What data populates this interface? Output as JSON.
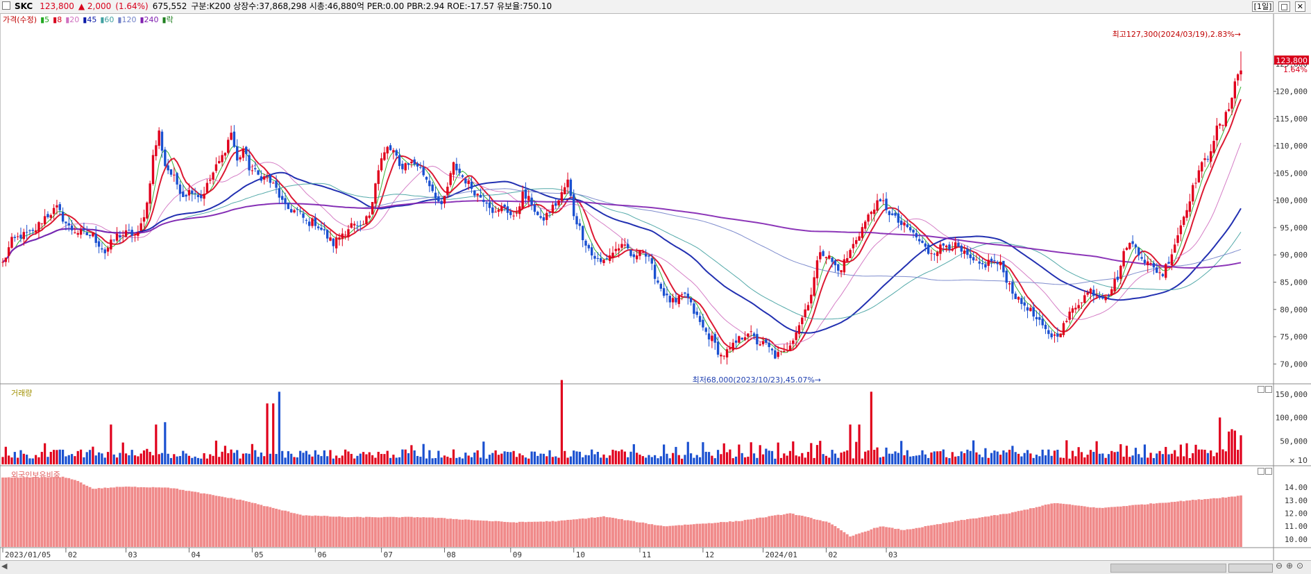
{
  "header": {
    "symbol": "SKC",
    "price": "123,800",
    "change": "▲ 2,000",
    "change_pct": "(1.64%)",
    "volume": "675,552",
    "info": "구분:K200 상장수:37,868,298 시총:46,880억 PER:0.00 PBR:2.94 ROE:-17.57 유보율:750.10",
    "period": "[1일]"
  },
  "price_legend": {
    "title": "가격(수정)",
    "ma": [
      {
        "label": "5",
        "color": "#21a821"
      },
      {
        "label": "8",
        "color": "#d8001c"
      },
      {
        "label": "20",
        "color": "#d070c0"
      },
      {
        "label": "45",
        "color": "#0a1aa8"
      },
      {
        "label": "60",
        "color": "#40a0a0"
      },
      {
        "label": "120",
        "color": "#7080c8"
      },
      {
        "label": "240",
        "color": "#8020b0"
      },
      {
        "label": "락",
        "color": "#208020"
      }
    ]
  },
  "volume_legend": {
    "title": "거래량"
  },
  "foreign_legend": {
    "title": "외국인보유비중"
  },
  "annotations": {
    "high": "최고127,300(2024/03/19),2.83%→",
    "low": "최저68,000(2023/10/23),45.07%→",
    "last_price": "123,800",
    "last_pct": "1.64%",
    "volume_unit": "× 10"
  },
  "colors": {
    "up": "#e0001c",
    "down": "#1a50d0",
    "foreign": "#f08a8a"
  },
  "chart_data": [
    {
      "type": "candlestick",
      "title": "가격(수정)",
      "ylim": [
        67000,
        131000
      ],
      "y_ticks": [
        "125,000",
        "120,000",
        "115,000",
        "110,000",
        "105,000",
        "100,000",
        "95,000",
        "90,000",
        "85,000",
        "80,000",
        "75,000",
        "70,000"
      ],
      "x_ticks": [
        "2023/01/05",
        "02",
        "03",
        "04",
        "05",
        "06",
        "07",
        "08",
        "09",
        "10",
        "11",
        "12",
        "2024/01",
        "02",
        "03"
      ],
      "close_path": [
        [
          0,
          88500
        ],
        [
          3,
          92500
        ],
        [
          6,
          93500
        ],
        [
          10,
          94000
        ],
        [
          14,
          97000
        ],
        [
          18,
          98500
        ],
        [
          22,
          95000
        ],
        [
          26,
          94000
        ],
        [
          30,
          93500
        ],
        [
          34,
          90500
        ],
        [
          38,
          93500
        ],
        [
          42,
          94000
        ],
        [
          45,
          93500
        ],
        [
          48,
          99500
        ],
        [
          50,
          108000
        ],
        [
          52,
          112500
        ],
        [
          54,
          106500
        ],
        [
          57,
          104000
        ],
        [
          60,
          101000
        ],
        [
          63,
          102000
        ],
        [
          66,
          100500
        ],
        [
          70,
          105000
        ],
        [
          73,
          108000
        ],
        [
          76,
          112500
        ],
        [
          78,
          107000
        ],
        [
          80,
          109500
        ],
        [
          82,
          106000
        ],
        [
          85,
          104500
        ],
        [
          88,
          104000
        ],
        [
          91,
          102000
        ],
        [
          94,
          98500
        ],
        [
          98,
          98000
        ],
        [
          101,
          96000
        ],
        [
          104,
          96000
        ],
        [
          107,
          94000
        ],
        [
          110,
          92000
        ],
        [
          113,
          94000
        ],
        [
          116,
          95500
        ],
        [
          119,
          94500
        ],
        [
          122,
          97500
        ],
        [
          124,
          103500
        ],
        [
          126,
          107500
        ],
        [
          128,
          109500
        ],
        [
          130,
          109000
        ],
        [
          132,
          106000
        ],
        [
          135,
          107000
        ],
        [
          138,
          106500
        ],
        [
          141,
          104000
        ],
        [
          144,
          101000
        ],
        [
          146,
          98500
        ],
        [
          148,
          102500
        ],
        [
          150,
          106500
        ],
        [
          152,
          105000
        ],
        [
          155,
          103000
        ],
        [
          158,
          101000
        ],
        [
          161,
          100000
        ],
        [
          164,
          97500
        ],
        [
          167,
          99000
        ],
        [
          170,
          96500
        ],
        [
          173,
          101000
        ],
        [
          176,
          99500
        ],
        [
          179,
          96000
        ],
        [
          182,
          98000
        ],
        [
          185,
          100000
        ],
        [
          188,
          103500
        ],
        [
          190,
          97500
        ],
        [
          193,
          93500
        ],
        [
          196,
          90000
        ],
        [
          199,
          88500
        ],
        [
          202,
          90000
        ],
        [
          205,
          91500
        ],
        [
          208,
          91000
        ],
        [
          210,
          89000
        ],
        [
          212,
          91500
        ],
        [
          215,
          89000
        ],
        [
          218,
          85000
        ],
        [
          221,
          82000
        ],
        [
          224,
          81000
        ],
        [
          227,
          83000
        ],
        [
          230,
          79500
        ],
        [
          233,
          76500
        ],
        [
          236,
          74500
        ],
        [
          239,
          71500
        ],
        [
          242,
          72500
        ],
        [
          245,
          74500
        ],
        [
          248,
          76000
        ],
        [
          251,
          74000
        ],
        [
          254,
          73500
        ],
        [
          257,
          71500
        ],
        [
          260,
          72000
        ],
        [
          263,
          75000
        ],
        [
          266,
          78500
        ],
        [
          269,
          83000
        ],
        [
          272,
          91000
        ],
        [
          275,
          89500
        ],
        [
          278,
          87000
        ],
        [
          281,
          89500
        ],
        [
          284,
          93000
        ],
        [
          287,
          96000
        ],
        [
          290,
          99000
        ],
        [
          293,
          99500
        ],
        [
          296,
          97000
        ],
        [
          299,
          95500
        ],
        [
          302,
          94500
        ],
        [
          305,
          92500
        ],
        [
          308,
          90500
        ],
        [
          311,
          91000
        ],
        [
          314,
          92000
        ],
        [
          317,
          91500
        ],
        [
          320,
          90000
        ],
        [
          323,
          88500
        ],
        [
          326,
          88000
        ],
        [
          329,
          89000
        ],
        [
          332,
          88000
        ],
        [
          335,
          84500
        ],
        [
          338,
          81500
        ],
        [
          341,
          80500
        ],
        [
          344,
          78000
        ],
        [
          347,
          76000
        ],
        [
          350,
          75000
        ],
        [
          353,
          77000
        ],
        [
          356,
          80000
        ],
        [
          359,
          82000
        ],
        [
          362,
          83500
        ],
        [
          365,
          82500
        ],
        [
          368,
          83000
        ],
        [
          371,
          86000
        ],
        [
          374,
          92000
        ],
        [
          377,
          91500
        ],
        [
          380,
          89000
        ],
        [
          383,
          87500
        ],
        [
          386,
          86500
        ],
        [
          389,
          90500
        ],
        [
          392,
          95500
        ],
        [
          395,
          100500
        ],
        [
          398,
          105500
        ],
        [
          401,
          108000
        ],
        [
          404,
          113000
        ],
        [
          406,
          114000
        ],
        [
          408,
          117000
        ],
        [
          410,
          122000
        ],
        [
          412,
          123800
        ]
      ]
    },
    {
      "type": "bar",
      "title": "거래량",
      "unit": "× 10",
      "ylim": [
        0,
        1600000
      ],
      "y_ticks": [
        "150,000",
        "100,000",
        "50,000"
      ]
    },
    {
      "type": "bar",
      "title": "외국인보유비중",
      "ylim": [
        9.4,
        15.3
      ],
      "y_ticks": [
        "14.00",
        "13.00",
        "12.00",
        "11.00",
        "10.00"
      ],
      "path": [
        [
          0,
          14.75
        ],
        [
          20,
          14.8
        ],
        [
          24,
          14.6
        ],
        [
          30,
          13.9
        ],
        [
          40,
          14.05
        ],
        [
          55,
          14.0
        ],
        [
          80,
          13.0
        ],
        [
          90,
          12.4
        ],
        [
          100,
          11.85
        ],
        [
          115,
          11.7
        ],
        [
          140,
          11.7
        ],
        [
          170,
          11.3
        ],
        [
          185,
          11.4
        ],
        [
          200,
          11.75
        ],
        [
          220,
          11.0
        ],
        [
          245,
          11.4
        ],
        [
          262,
          12.0
        ],
        [
          275,
          11.3
        ],
        [
          282,
          10.2
        ],
        [
          292,
          11.0
        ],
        [
          300,
          10.7
        ],
        [
          320,
          11.5
        ],
        [
          335,
          12.0
        ],
        [
          350,
          12.8
        ],
        [
          365,
          12.4
        ],
        [
          410,
          13.3
        ],
        [
          412,
          13.4
        ]
      ]
    }
  ]
}
